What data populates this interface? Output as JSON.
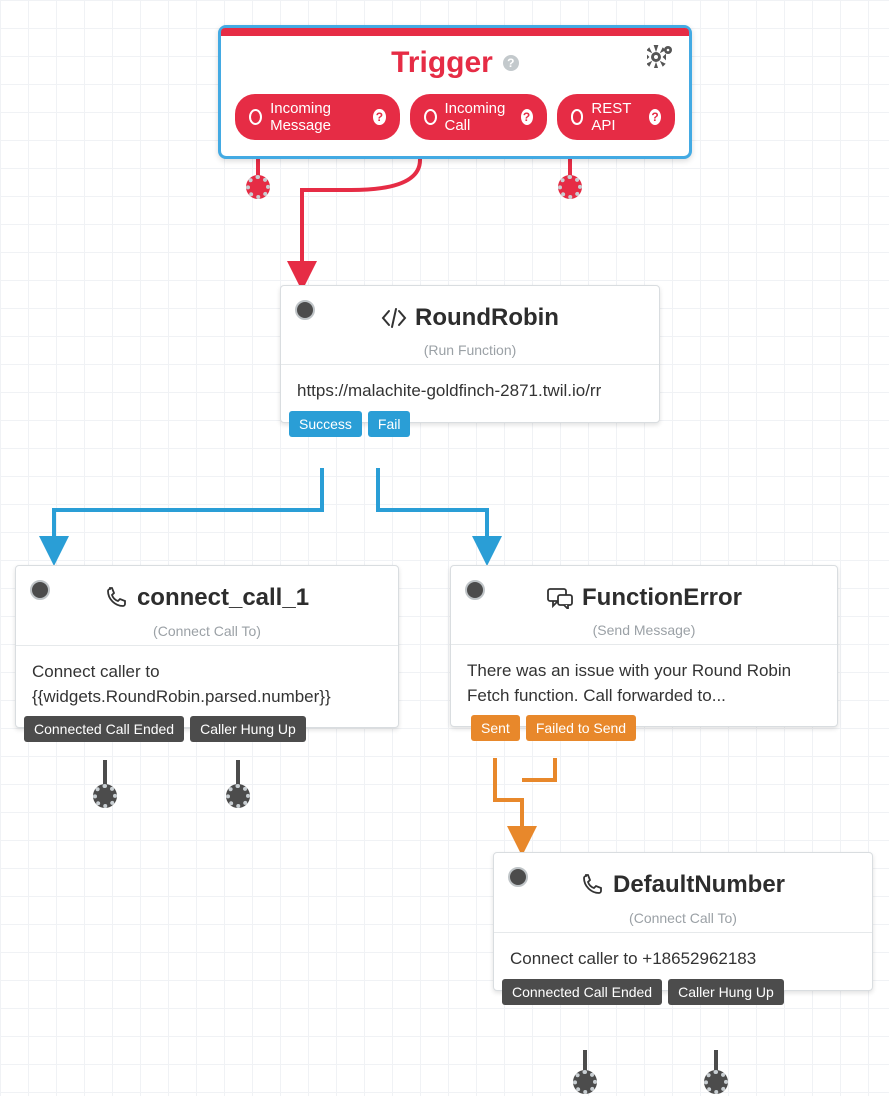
{
  "trigger": {
    "title": "Trigger",
    "pills": [
      "Incoming Message",
      "Incoming Call",
      "REST API"
    ]
  },
  "roundrobin": {
    "title": "RoundRobin",
    "sub": "(Run Function)",
    "body": "https://malachite-goldfinch-2871.twil.io/rr",
    "outs": [
      "Success",
      "Fail"
    ]
  },
  "connect1": {
    "title": "connect_call_1",
    "sub": "(Connect Call To)",
    "body": "Connect caller to {{widgets.RoundRobin.parsed.number}}",
    "outs": [
      "Connected Call Ended",
      "Caller Hung Up"
    ]
  },
  "ferror": {
    "title": "FunctionError",
    "sub": "(Send Message)",
    "body": "There was an issue with your Round Robin Fetch function. Call forwarded to...",
    "outs": [
      "Sent",
      "Failed to Send"
    ]
  },
  "defaultnum": {
    "title": "DefaultNumber",
    "sub": "(Connect Call To)",
    "body": "Connect caller to +18652962183",
    "outs": [
      "Connected Call Ended",
      "Caller Hung Up"
    ]
  }
}
